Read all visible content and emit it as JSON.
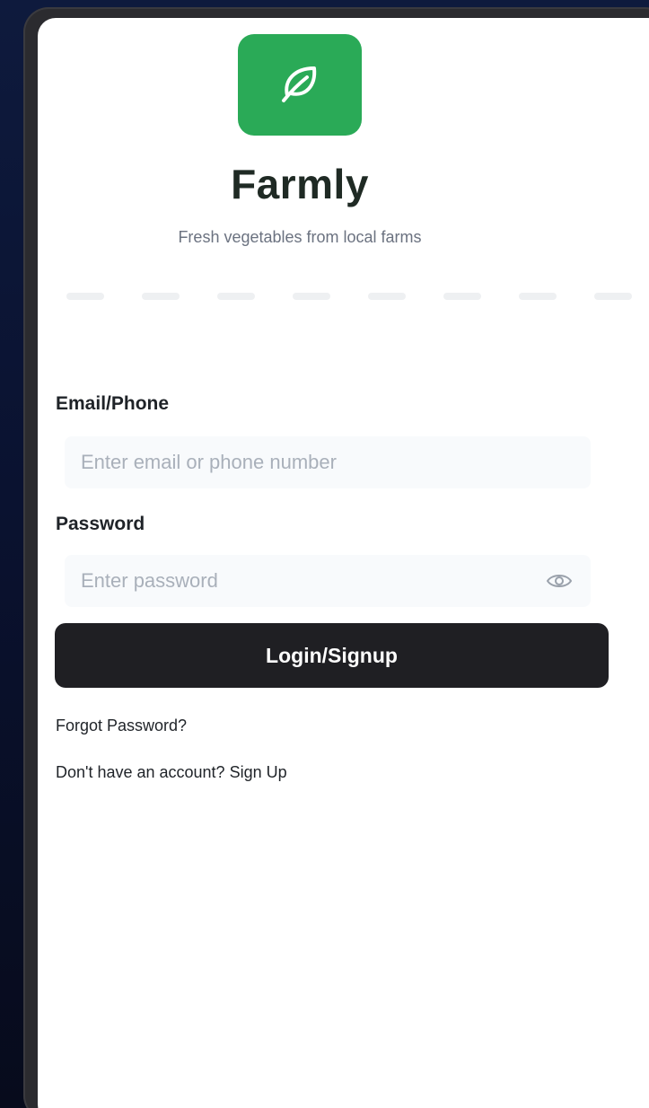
{
  "app": {
    "name": "Farmly",
    "tagline": "Fresh vegetables from local farms",
    "logo_icon": "leaf-icon",
    "brand_color": "#2aaa57"
  },
  "carousel": {
    "indicator_count": 8
  },
  "form": {
    "email": {
      "label": "Email/Phone",
      "placeholder": "Enter email or phone number",
      "value": ""
    },
    "password": {
      "label": "Password",
      "placeholder": "Enter password",
      "value": "",
      "toggle_icon": "eye-icon"
    },
    "submit_label": "Login/Signup",
    "forgot_password_label": "Forgot Password?",
    "signup_prompt": "Don't have an account? Sign Up"
  },
  "colors": {
    "button_bg": "#1f1f23",
    "background_top": "#0e1a3d"
  }
}
